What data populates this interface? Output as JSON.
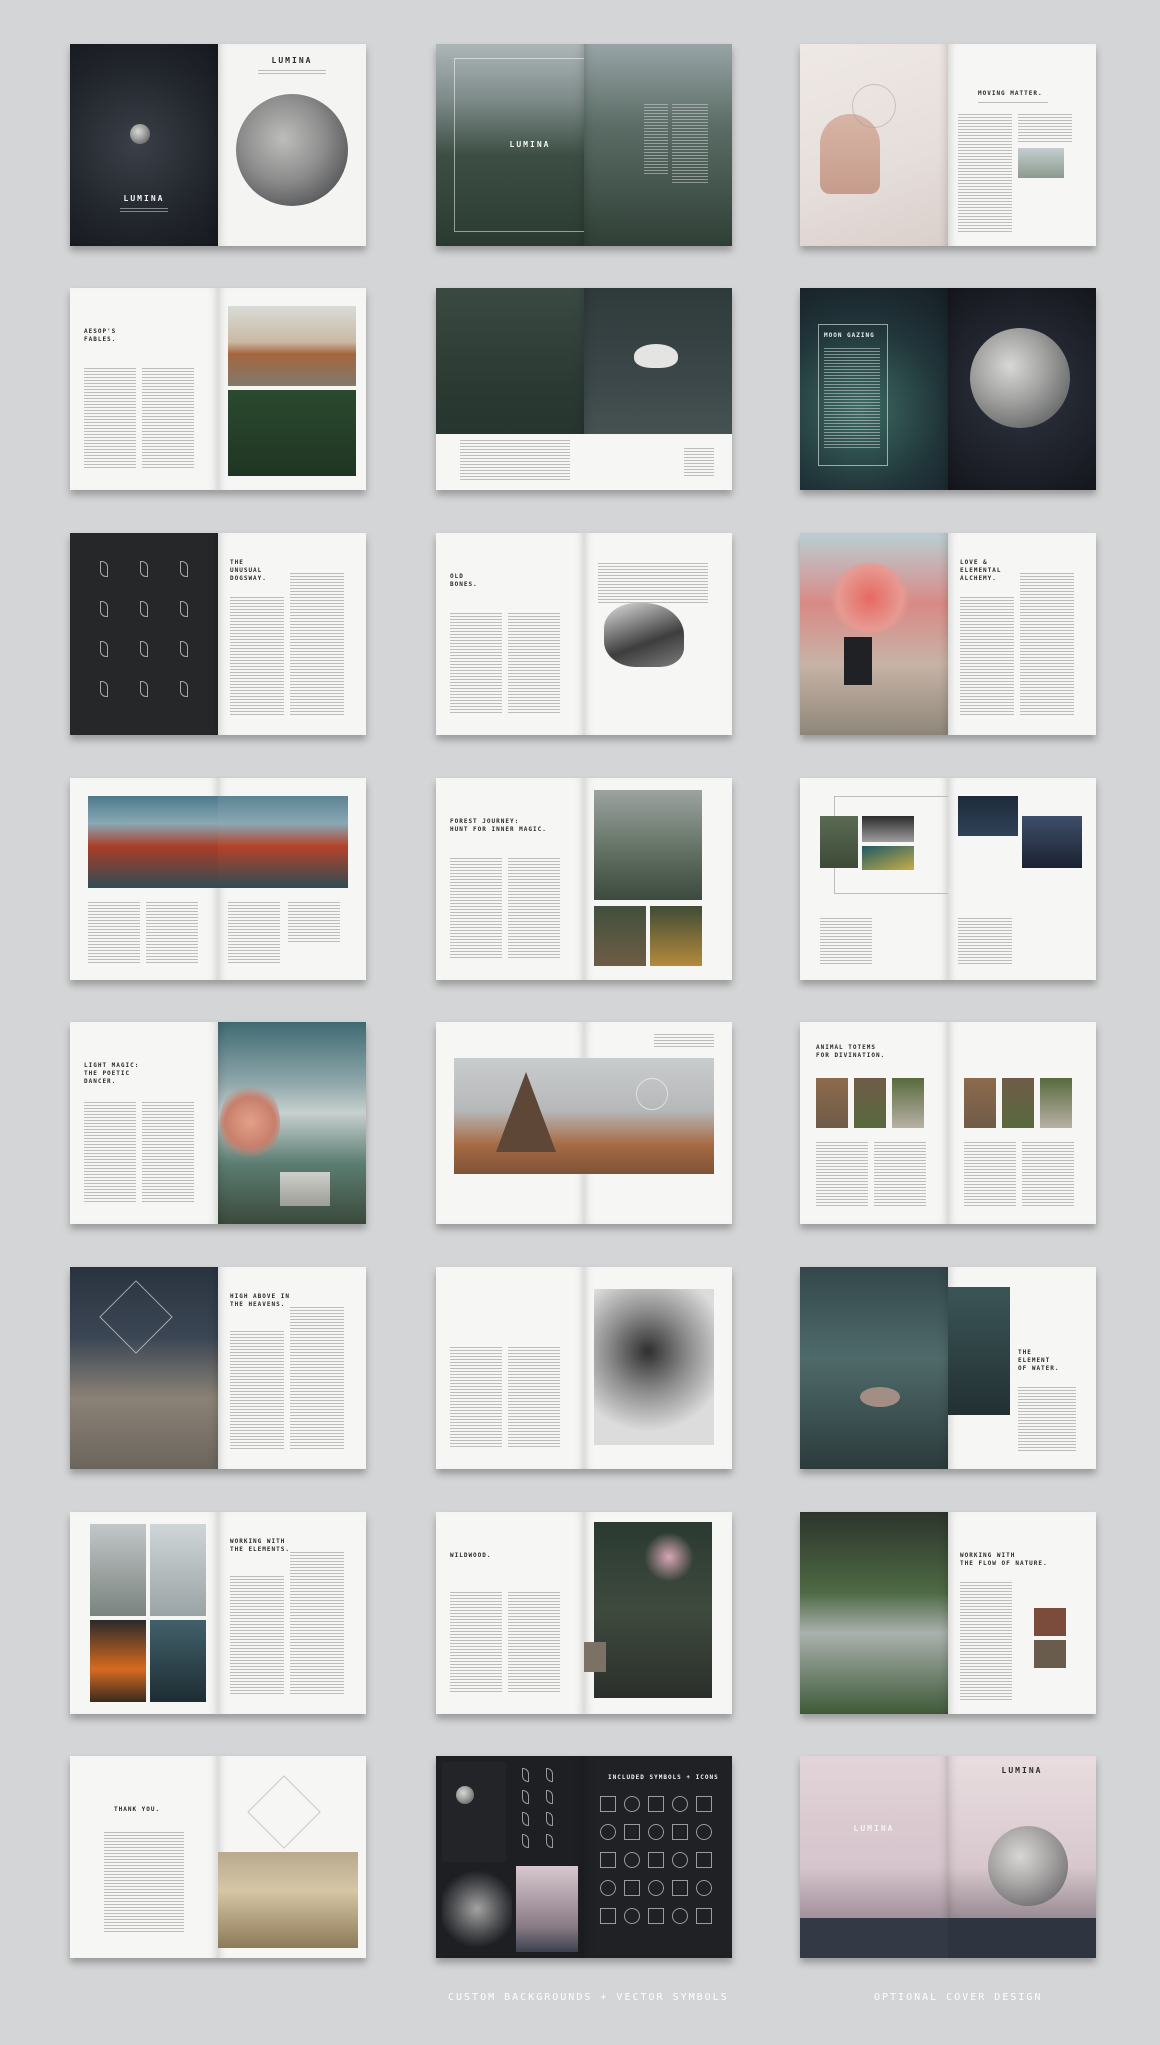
{
  "brand": "LUMINA",
  "captions": {
    "symbols": "CUSTOM BACKGROUNDS + VECTOR SYMBOLS",
    "cover": "OPTIONAL COVER DESIGN"
  },
  "spreads": [
    {
      "id": "cover-spread",
      "left": "cover-dark",
      "right": "cover-moon",
      "headline": ""
    },
    {
      "id": "contents-spread",
      "left": "photo-cliff",
      "right": "contents",
      "headline": ""
    },
    {
      "id": "moving-matter",
      "left": "photo-hands",
      "right": "article-photo-small",
      "headline": "MOVING MATTER."
    },
    {
      "id": "aesops-fables",
      "left": "article",
      "right": "photo-fox-duo",
      "headline": "AESOP'S\nFABLES."
    },
    {
      "id": "swan-spread",
      "left": "photo-moss",
      "right": "photo-swan",
      "headline": ""
    },
    {
      "id": "moon-gazing",
      "left": "photo-nebula",
      "right": "cover-moon-dark",
      "headline": "MOON GAZING"
    },
    {
      "id": "unusual-dogsway",
      "left": "pattern-dark",
      "right": "article-columns",
      "headline": "THE\nUNUSUAL\nDOGSWAY."
    },
    {
      "id": "old-bones",
      "left": "article",
      "right": "photo-bird",
      "headline": "OLD\nBONES."
    },
    {
      "id": "love-alchemy",
      "left": "photo-smoke",
      "right": "article-columns",
      "headline": "LOVE &\nELEMENTAL\nALCHEMY."
    },
    {
      "id": "lava-spread",
      "left": "photo-lava",
      "right": "photo-lava-text",
      "headline": ""
    },
    {
      "id": "forest-journey",
      "left": "article",
      "right": "photo-forest-duo",
      "headline": "FOREST JOURNEY:\nHUNT FOR INNER MAGIC."
    },
    {
      "id": "collage-spread",
      "left": "collage-left",
      "right": "collage-right",
      "headline": ""
    },
    {
      "id": "light-magic",
      "left": "article",
      "right": "photo-sky",
      "headline": "LIGHT MAGIC:\nTHE POETIC\nDANCER."
    },
    {
      "id": "teepee-spread",
      "left": "photo-teepee",
      "right": "photo-teepee-right",
      "headline": ""
    },
    {
      "id": "animal-totems",
      "left": "animal-grid",
      "right": "animal-grid",
      "headline": "ANIMAL TOTEMS\nFOR DIVINATION."
    },
    {
      "id": "high-heavens",
      "left": "photo-rocks",
      "right": "article-columns",
      "headline": "HIGH ABOVE IN\nTHE HEAVENS."
    },
    {
      "id": "portrait-spread",
      "left": "article",
      "right": "photo-portrait",
      "headline": ""
    },
    {
      "id": "element-water",
      "left": "photo-water",
      "right": "photo-water-right",
      "headline": "THE\nELEMENT\nOF WATER."
    },
    {
      "id": "working-elements",
      "left": "photo-quad",
      "right": "article-columns",
      "headline": "WORKING WITH\nTHE ELEMENTS."
    },
    {
      "id": "wildwood",
      "left": "article",
      "right": "photo-blossom",
      "headline": "WILDWOOD."
    },
    {
      "id": "flow-nature",
      "left": "photo-stream",
      "right": "article-photo-side",
      "headline": "WORKING WITH\nTHE FLOW OF NATURE."
    },
    {
      "id": "thank-you",
      "left": "article-center",
      "right": "photo-dunes",
      "headline": "THANK YOU."
    },
    {
      "id": "symbols-spread",
      "left": "symbols-left",
      "right": "symbols-right",
      "headline": "INCLUDED SYMBOLS + ICONS"
    },
    {
      "id": "optional-cover",
      "left": "cover-pink",
      "right": "cover-pink-right",
      "headline": ""
    }
  ]
}
